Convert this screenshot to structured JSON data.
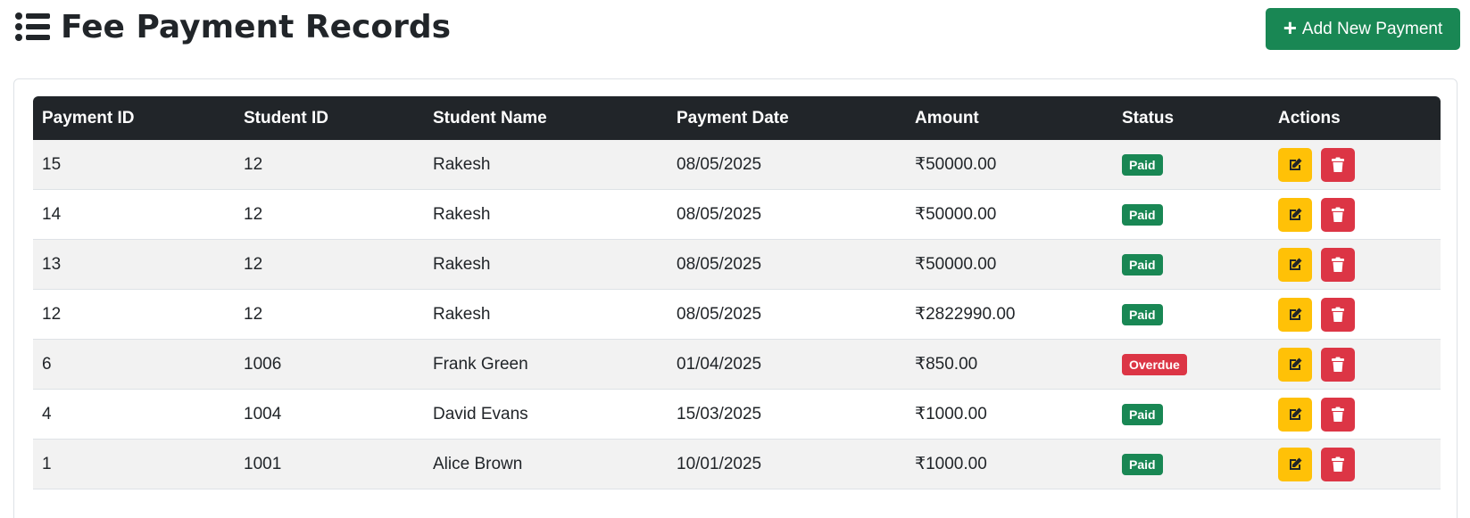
{
  "header": {
    "title": "Fee Payment Records",
    "title_icon": "list-icon",
    "add_button_label": "Add New Payment",
    "add_button_icon": "plus-icon"
  },
  "colors": {
    "success": "#198754",
    "danger": "#dc3545",
    "warning": "#ffc107",
    "header_dark": "#212529"
  },
  "table": {
    "columns": [
      "Payment ID",
      "Student ID",
      "Student Name",
      "Payment Date",
      "Amount",
      "Status",
      "Actions"
    ],
    "rows": [
      {
        "payment_id": "15",
        "student_id": "12",
        "student_name": "Rakesh",
        "payment_date": "08/05/2025",
        "amount": "₹50000.00",
        "status": "Paid",
        "status_type": "paid"
      },
      {
        "payment_id": "14",
        "student_id": "12",
        "student_name": "Rakesh",
        "payment_date": "08/05/2025",
        "amount": "₹50000.00",
        "status": "Paid",
        "status_type": "paid"
      },
      {
        "payment_id": "13",
        "student_id": "12",
        "student_name": "Rakesh",
        "payment_date": "08/05/2025",
        "amount": "₹50000.00",
        "status": "Paid",
        "status_type": "paid"
      },
      {
        "payment_id": "12",
        "student_id": "12",
        "student_name": "Rakesh",
        "payment_date": "08/05/2025",
        "amount": "₹2822990.00",
        "status": "Paid",
        "status_type": "paid"
      },
      {
        "payment_id": "6",
        "student_id": "1006",
        "student_name": "Frank Green",
        "payment_date": "01/04/2025",
        "amount": "₹850.00",
        "status": "Overdue",
        "status_type": "overdue"
      },
      {
        "payment_id": "4",
        "student_id": "1004",
        "student_name": "David Evans",
        "payment_date": "15/03/2025",
        "amount": "₹1000.00",
        "status": "Paid",
        "status_type": "paid"
      },
      {
        "payment_id": "1",
        "student_id": "1001",
        "student_name": "Alice Brown",
        "payment_date": "10/01/2025",
        "amount": "₹1000.00",
        "status": "Paid",
        "status_type": "paid"
      }
    ],
    "row_actions": {
      "edit_icon": "edit-icon",
      "delete_icon": "trash-icon"
    }
  }
}
